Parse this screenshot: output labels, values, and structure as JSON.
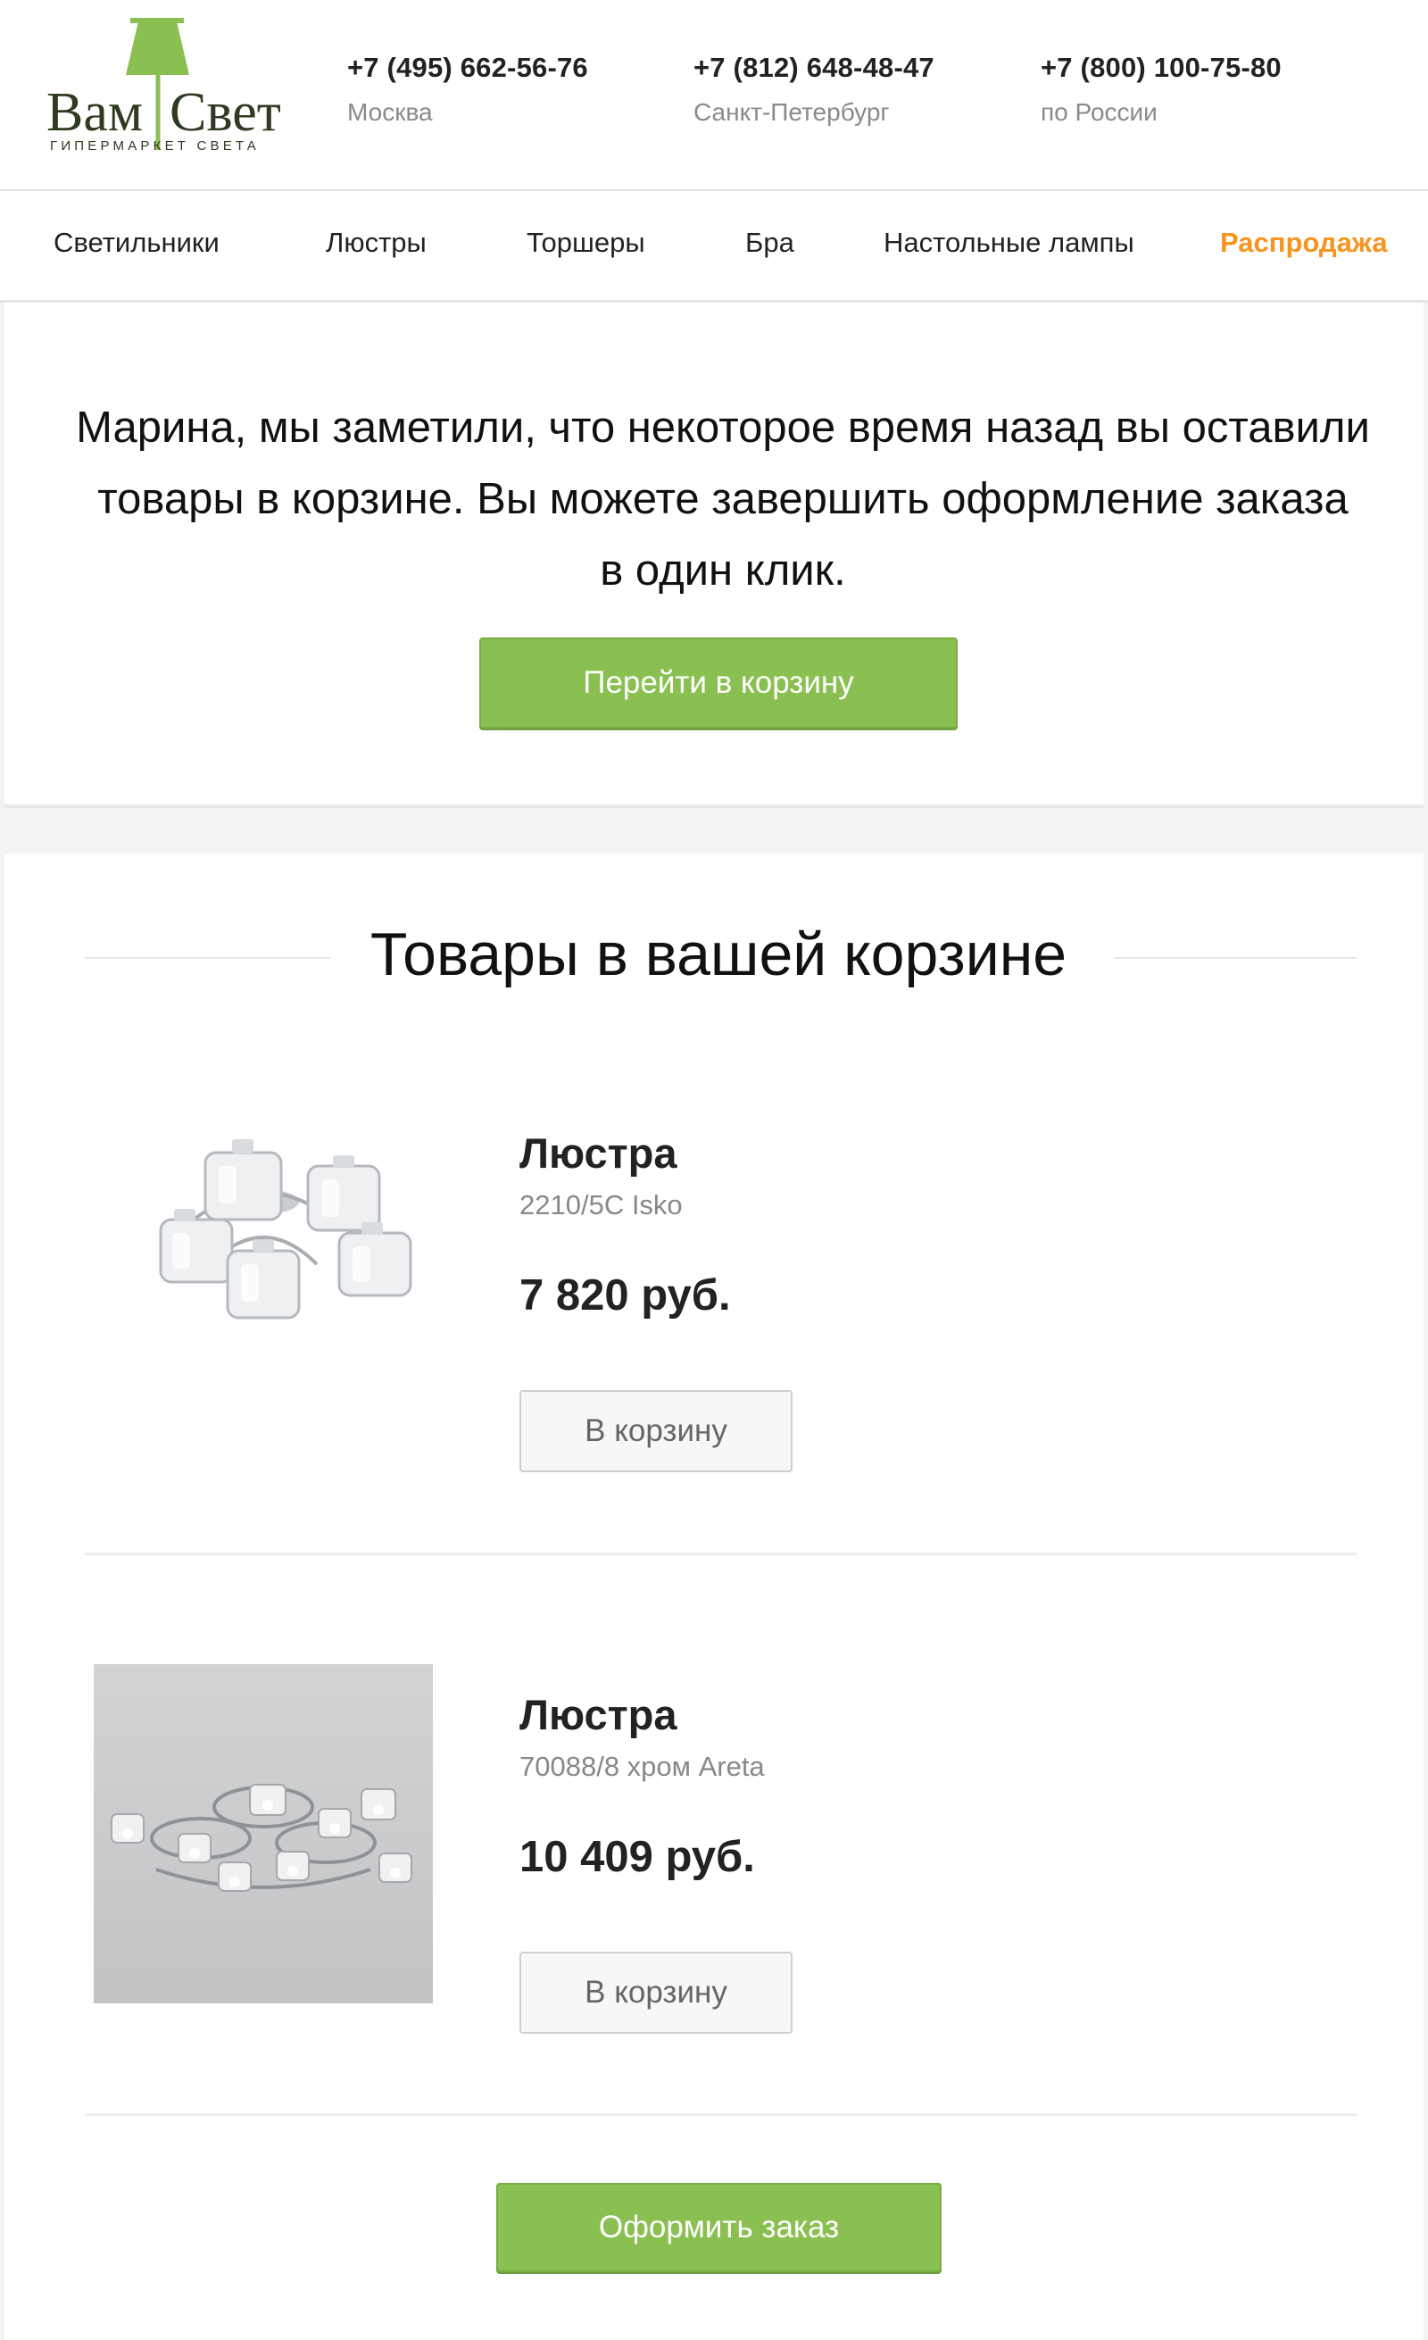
{
  "brand": {
    "name_left": "Вам",
    "name_right": "Свет",
    "tagline": "ГИПЕРМАРКЕТ СВЕТА",
    "brand_green": "#8ac051"
  },
  "phones": [
    {
      "number": "+7 (495) 662-56-76",
      "city": "Москва"
    },
    {
      "number": "+7 (812) 648-48-47",
      "city": "Санкт-Петербург"
    },
    {
      "number": "+7 (800) 100-75-80",
      "city": "по России"
    }
  ],
  "nav": {
    "items": [
      {
        "label": "Светильники"
      },
      {
        "label": "Люстры"
      },
      {
        "label": "Торшеры"
      },
      {
        "label": "Бра"
      },
      {
        "label": "Настольные лампы"
      },
      {
        "label": "Распродажа",
        "accent": "#f7941d"
      }
    ]
  },
  "intro": {
    "line1": "Марина, мы заметили, что некоторое время назад вы оставили",
    "line2": "товары в корзине. Вы можете завершить оформление заказа",
    "line3": "в один клик.",
    "button_label": "Перейти в корзину"
  },
  "cart": {
    "title": "Товары в вашей корзине",
    "products": [
      {
        "name": "Люстра",
        "sku": "2210/5C Isko",
        "price": "7 820 руб.",
        "button_label": "В корзину",
        "image_icon": "chandelier-glass-shades-image"
      },
      {
        "name": "Люстра",
        "sku": "70088/8 хром Areta",
        "price": "10 409 руб.",
        "button_label": "В корзину",
        "image_icon": "chandelier-chrome-rings-image"
      }
    ],
    "order_button_label": "Оформить заказ"
  }
}
